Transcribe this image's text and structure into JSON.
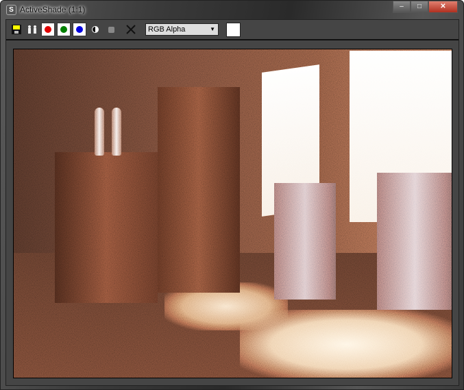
{
  "window": {
    "title": "ActiveShade (1:1)",
    "app_icon": "3ds-max-icon",
    "controls": {
      "minimize": "–",
      "maximize": "□",
      "close": "✕"
    }
  },
  "toolbar": {
    "save_icon": "save-icon",
    "clone_icon": "clone-icon",
    "channels": {
      "red": "#e00000",
      "green": "#008000",
      "blue": "#0000e0"
    },
    "channel_dropdown": "RGB Alpha",
    "swatch_color": "#ffffff"
  },
  "viewport": {
    "content": "rendered interior scene"
  }
}
